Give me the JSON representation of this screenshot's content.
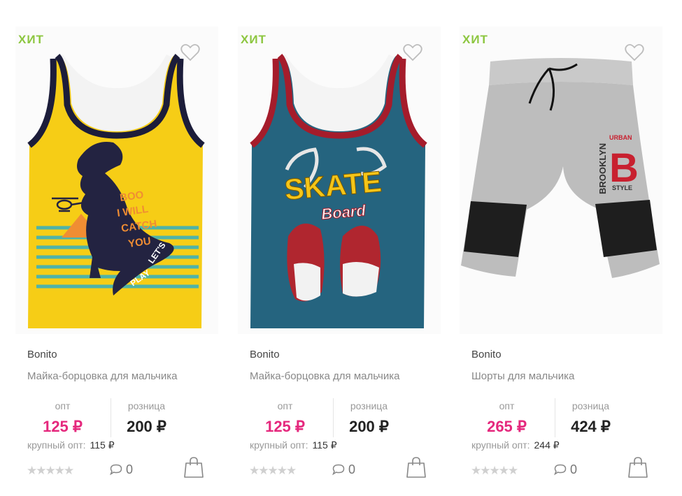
{
  "products": [
    {
      "badge": "ХИТ",
      "brand": "Bonito",
      "name": "Майка-борцовка для мальчика",
      "opt_label": "опт",
      "opt_price": "125 ₽",
      "retail_label": "розница",
      "retail_price": "200 ₽",
      "bulk_label": "крупный опт:",
      "bulk_price": "115 ₽",
      "comments": "0",
      "image": "yellow-dinosaur-tank-top",
      "print_text": [
        "BOO",
        "I WILL",
        "CATCH",
        "YOU",
        "LET'S",
        "PLAY"
      ]
    },
    {
      "badge": "ХИТ",
      "brand": "Bonito",
      "name": "Майка-борцовка для мальчика",
      "opt_label": "опт",
      "opt_price": "125 ₽",
      "retail_label": "розница",
      "retail_price": "200 ₽",
      "bulk_label": "крупный опт:",
      "bulk_price": "115 ₽",
      "comments": "0",
      "image": "blue-skate-board-tank-top",
      "print_text": [
        "SKATE",
        "Board"
      ]
    },
    {
      "badge": "ХИТ",
      "brand": "Bonito",
      "name": "Шорты для мальчика",
      "opt_label": "опт",
      "opt_price": "265 ₽",
      "retail_label": "розница",
      "retail_price": "424 ₽",
      "bulk_label": "крупный опт:",
      "bulk_price": "244 ₽",
      "comments": "0",
      "image": "grey-brooklyn-shorts",
      "print_text": [
        "BROOKLYN",
        "URBAN",
        "B",
        "STYLE"
      ]
    }
  ],
  "icons": {
    "favorite": "heart-outline-icon",
    "comment": "speech-bubble-icon",
    "cart": "shopping-bag-icon",
    "rating": "star-icon"
  },
  "colors": {
    "badge": "#8cc63f",
    "opt_price": "#e5287d",
    "retail_price": "#222222",
    "star_empty": "#d0d0d0"
  }
}
